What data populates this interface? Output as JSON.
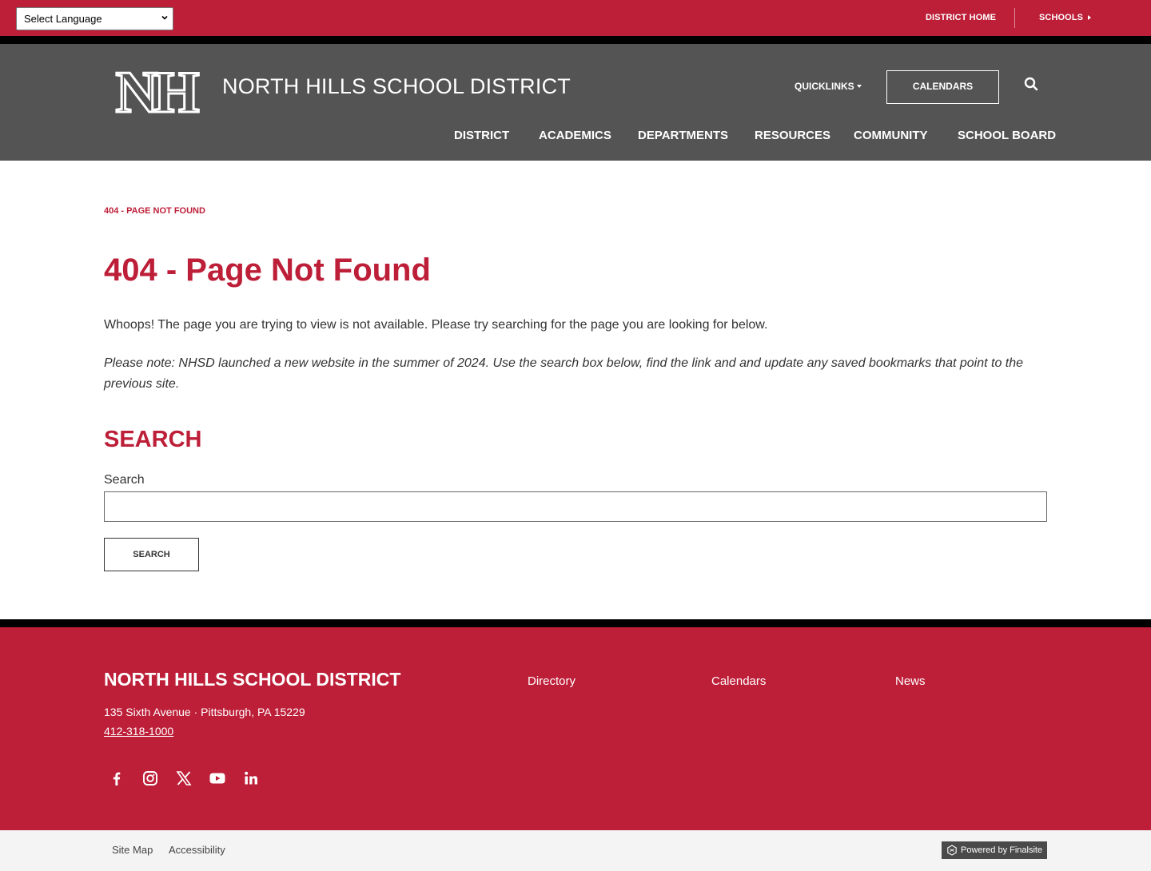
{
  "topbar": {
    "language_select": "Select Language",
    "district_home": "DISTRICT HOME",
    "schools": "SCHOOLS"
  },
  "header": {
    "logo_text": "NH",
    "site_title": "NORTH HILLS SCHOOL DISTRICT",
    "quicklinks": "QUICKLINKS",
    "calendars": "CALENDARS",
    "nav": [
      "DISTRICT",
      "ACADEMICS",
      "DEPARTMENTS",
      "RESOURCES",
      "COMMUNITY",
      "SCHOOL BOARD"
    ]
  },
  "main": {
    "breadcrumb": "404 - PAGE NOT FOUND",
    "title": "404 - Page Not Found",
    "intro": "Whoops! The page you are trying to view is not available. Please try searching for the page you are looking for below.",
    "note": "Please note: NHSD launched a new website in the summer of 2024. Use the search box below, find the link and and update any saved bookmarks that point to the previous site.",
    "search_heading": "SEARCH",
    "search_label": "Search",
    "search_value": "",
    "search_button": "SEARCH"
  },
  "footer": {
    "title": "NORTH HILLS SCHOOL DISTRICT",
    "address": "135 Sixth Avenue   · Pittsburgh, PA  15229",
    "phone": "412-318-1000",
    "links": [
      "Directory",
      "Calendars",
      "News"
    ],
    "social": [
      "facebook-icon",
      "instagram-icon",
      "x-twitter-icon",
      "youtube-icon",
      "linkedin-icon"
    ]
  },
  "subfooter": {
    "site_map": "Site Map",
    "accessibility": "Accessibility",
    "powered_by": "Powered by Finalsite"
  },
  "colors": {
    "brand_red": "#bd1e38",
    "header_gray": "#545454",
    "black": "#000000"
  }
}
